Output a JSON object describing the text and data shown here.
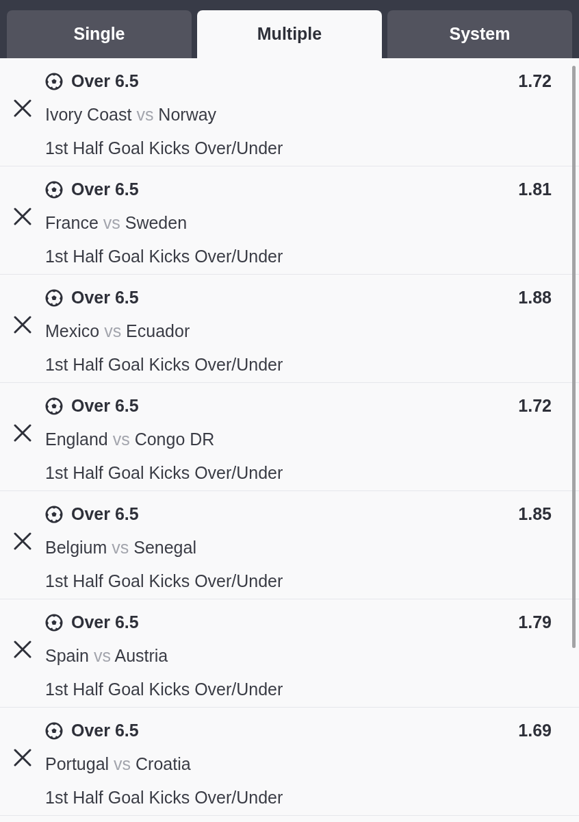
{
  "tabs": [
    {
      "label": "Single",
      "selected": false
    },
    {
      "label": "Multiple",
      "selected": true
    },
    {
      "label": "System",
      "selected": false
    }
  ],
  "selections": [
    {
      "pick": "Over 6.5",
      "odds": "1.72",
      "home": "Ivory Coast",
      "separator": "vs",
      "away": "Norway",
      "market": "1st Half Goal Kicks Over/Under"
    },
    {
      "pick": "Over 6.5",
      "odds": "1.81",
      "home": "France",
      "separator": "vs",
      "away": "Sweden",
      "market": "1st Half Goal Kicks Over/Under"
    },
    {
      "pick": "Over 6.5",
      "odds": "1.88",
      "home": "Mexico",
      "separator": "vs",
      "away": "Ecuador",
      "market": "1st Half Goal Kicks Over/Under"
    },
    {
      "pick": "Over 6.5",
      "odds": "1.72",
      "home": "England",
      "separator": "vs",
      "away": "Congo DR",
      "market": "1st Half Goal Kicks Over/Under"
    },
    {
      "pick": "Over 6.5",
      "odds": "1.85",
      "home": "Belgium",
      "separator": "vs",
      "away": "Senegal",
      "market": "1st Half Goal Kicks Over/Under"
    },
    {
      "pick": "Over 6.5",
      "odds": "1.79",
      "home": "Spain",
      "separator": "vs",
      "away": "Austria",
      "market": "1st Half Goal Kicks Over/Under"
    },
    {
      "pick": "Over 6.5",
      "odds": "1.69",
      "home": "Portugal",
      "separator": "vs",
      "away": "Croatia",
      "market": "1st Half Goal Kicks Over/Under"
    }
  ]
}
